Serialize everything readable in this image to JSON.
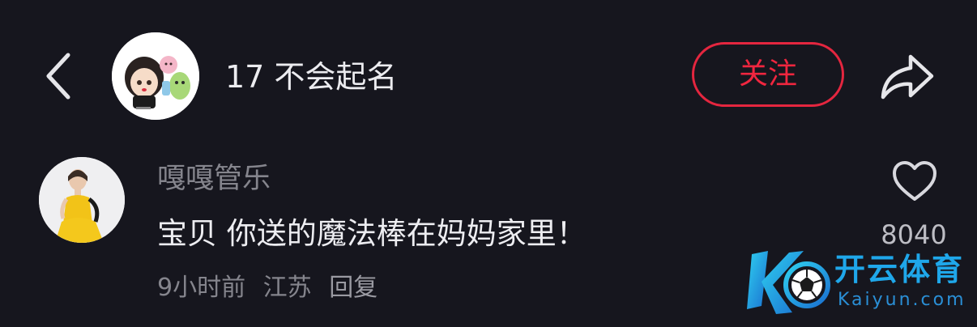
{
  "header": {
    "username": "17 不会起名",
    "follow_label": "关注",
    "back_icon": "chevron-left-icon",
    "share_icon": "share-arrow-icon"
  },
  "comment": {
    "author": "嘎嘎管乐",
    "text": "宝贝 你送的魔法棒在妈妈家里！",
    "time": "9小时前",
    "location": "江苏",
    "reply_label": "回复",
    "like_count": "8040",
    "like_icon": "heart-outline-icon"
  },
  "watermark": {
    "cn_text": "开云体育",
    "en_text": "Kaiyun.com"
  },
  "colors": {
    "background": "#16161e",
    "accent_red": "#e4263f",
    "secondary_text": "#85858d",
    "primary_text": "#ededf1",
    "watermark_blue": "#1fa7ea"
  }
}
